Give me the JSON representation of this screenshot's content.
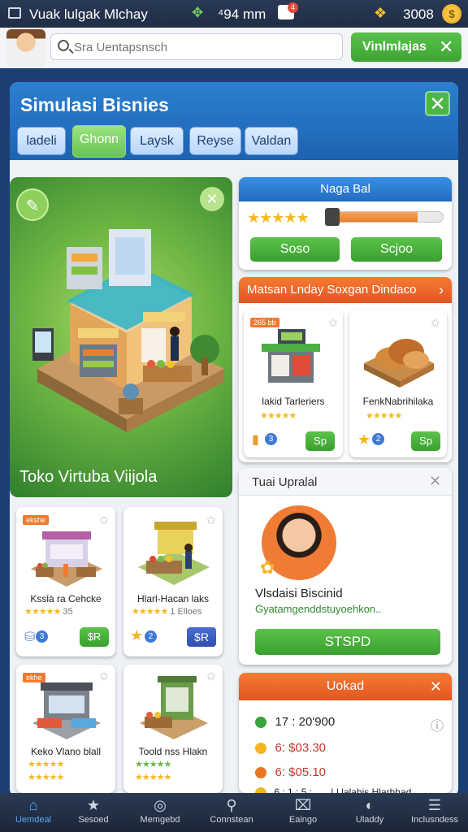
{
  "statusbar": {
    "title": "Vuak lulgak Mlchay",
    "gems": "⁴94 mm",
    "bag_badge": "4",
    "coins": "3008",
    "coin_symbol": "$"
  },
  "search": {
    "placeholder": "Sra Uentapsnsch"
  },
  "top_button": {
    "label": "Vinlmlajas"
  },
  "panel": {
    "title": "Simulasi Bisnies",
    "tabs": [
      {
        "label": "ladeli"
      },
      {
        "label": "Ghonn"
      },
      {
        "label": "Laysk"
      },
      {
        "label": "Reyse"
      },
      {
        "label": "Valdan"
      }
    ]
  },
  "hero": {
    "caption": "Toko Virtuba Viijola"
  },
  "naga": {
    "title": "Naga Bal",
    "rating": 5,
    "progress": 0.78,
    "buttons": [
      "Soso",
      "Scjoo"
    ]
  },
  "market": {
    "title": "Matsan Lnday Soxgan Dindaco",
    "items": [
      {
        "tag": "265 bb",
        "name": "lakid Tarleriers",
        "rating": 5,
        "count": "3",
        "price": "Sp"
      },
      {
        "tag": "",
        "name": "FenkNabrihilaka",
        "rating": 5,
        "count": "2",
        "price": "Sp"
      }
    ]
  },
  "upgrade": {
    "title": "Tuai Upralal",
    "name": "Vlsdaisi Biscinid",
    "desc": "Gyatamgenddstuyoehkon..",
    "button": "STSPD"
  },
  "shops": [
    {
      "tag": "ekshe",
      "name": "Ksslà ra Cehcke",
      "rating": 5,
      "count": "35",
      "badge": "3",
      "price": "$R"
    },
    {
      "tag": "",
      "name": "Hlarl-Hacan laks",
      "rating": 5,
      "count": "1 Elloes",
      "badge": "2",
      "price": "$R"
    },
    {
      "tag": "ekhe",
      "name": "Keko Vlano blall",
      "rating": 5,
      "count": "",
      "badge": "",
      "price": ""
    },
    {
      "tag": "",
      "name": "Toold nss Hlakn",
      "rating": 5,
      "count": "",
      "badge": "",
      "price": ""
    }
  ],
  "uokad": {
    "title": "Uokad",
    "rows": [
      {
        "label": "17 : 20'900",
        "color": "#3aa53a"
      },
      {
        "label": "6: $03.30",
        "color": "#f2b523"
      },
      {
        "label": "6: $05.10",
        "color": "#e8761f"
      },
      {
        "label": "6 : 1 : 5 : . . .   | | lalahis Hlarhhad",
        "color": "#f2b523"
      }
    ]
  },
  "nav": [
    {
      "label": "Uemdeal",
      "icon": "home"
    },
    {
      "label": "Sesoed",
      "icon": "star"
    },
    {
      "label": "Memgebd",
      "icon": "globe"
    },
    {
      "label": "Connstean",
      "icon": "search"
    },
    {
      "label": "Eaingo",
      "icon": "store"
    },
    {
      "label": "Uladdy",
      "icon": "chart"
    },
    {
      "label": "Inclusndess",
      "icon": "menu"
    }
  ]
}
